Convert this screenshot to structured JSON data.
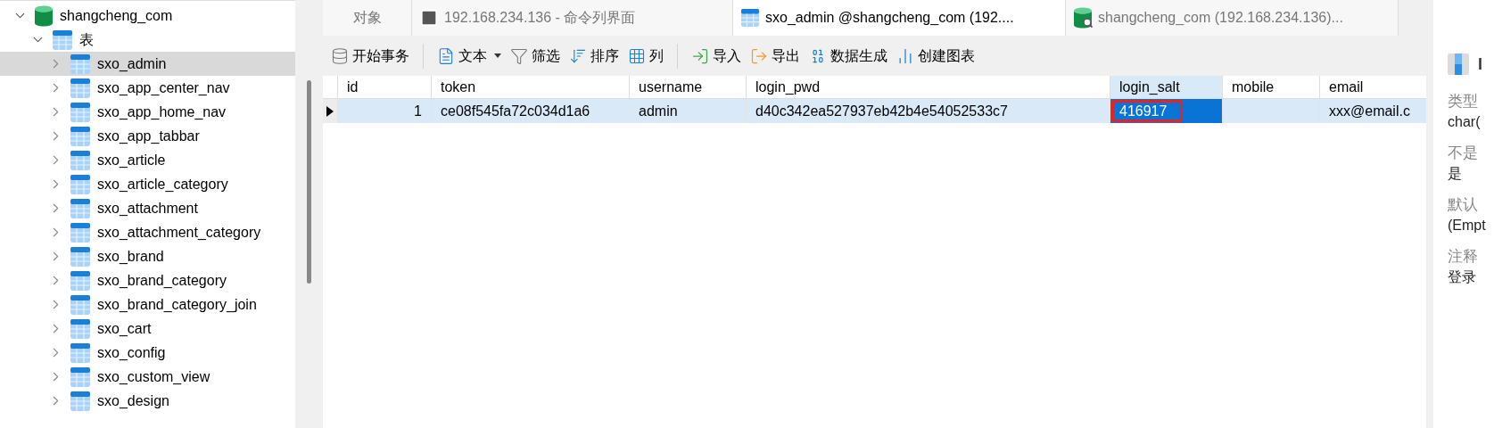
{
  "sidebar": {
    "tree": [
      {
        "label": "shangcheng_com",
        "kind": "database",
        "expanded": true,
        "selected": false,
        "children": [
          {
            "label": "表",
            "kind": "folder",
            "expanded": true,
            "selected": false,
            "children": [
              {
                "label": "sxo_admin",
                "kind": "table",
                "expanded": false,
                "selected": true
              },
              {
                "label": "sxo_app_center_nav",
                "kind": "table",
                "expanded": false,
                "selected": false
              },
              {
                "label": "sxo_app_home_nav",
                "kind": "table",
                "expanded": false,
                "selected": false
              },
              {
                "label": "sxo_app_tabbar",
                "kind": "table",
                "expanded": false,
                "selected": false
              },
              {
                "label": "sxo_article",
                "kind": "table",
                "expanded": false,
                "selected": false
              },
              {
                "label": "sxo_article_category",
                "kind": "table",
                "expanded": false,
                "selected": false
              },
              {
                "label": "sxo_attachment",
                "kind": "table",
                "expanded": false,
                "selected": false
              },
              {
                "label": "sxo_attachment_category",
                "kind": "table",
                "expanded": false,
                "selected": false
              },
              {
                "label": "sxo_brand",
                "kind": "table",
                "expanded": false,
                "selected": false
              },
              {
                "label": "sxo_brand_category",
                "kind": "table",
                "expanded": false,
                "selected": false
              },
              {
                "label": "sxo_brand_category_join",
                "kind": "table",
                "expanded": false,
                "selected": false
              },
              {
                "label": "sxo_cart",
                "kind": "table",
                "expanded": false,
                "selected": false
              },
              {
                "label": "sxo_config",
                "kind": "table",
                "expanded": false,
                "selected": false
              },
              {
                "label": "sxo_custom_view",
                "kind": "table",
                "expanded": false,
                "selected": false
              },
              {
                "label": "sxo_design",
                "kind": "table",
                "expanded": false,
                "selected": false
              }
            ]
          }
        ]
      }
    ]
  },
  "tabs": [
    {
      "label": "对象",
      "kind": "objects",
      "selected": false
    },
    {
      "label": "192.168.234.136 - 命令列界面",
      "kind": "console",
      "selected": false
    },
    {
      "label": "sxo_admin @shangcheng_com (192....",
      "kind": "table",
      "selected": true
    },
    {
      "label": "shangcheng_com (192.168.234.136)...",
      "kind": "database",
      "selected": false
    }
  ],
  "toolbar": [
    {
      "label": "开始事务",
      "kind": "transaction",
      "has_menu": false
    },
    {
      "label": "文本",
      "kind": "text",
      "has_menu": true
    },
    {
      "label": "筛选",
      "kind": "filter",
      "has_menu": false
    },
    {
      "label": "排序",
      "kind": "sort",
      "has_menu": false
    },
    {
      "label": "列",
      "kind": "columns",
      "has_menu": false
    },
    {
      "label": "导入",
      "kind": "import",
      "has_menu": false
    },
    {
      "label": "导出",
      "kind": "export",
      "has_menu": false
    },
    {
      "label": "数据生成",
      "kind": "generate",
      "has_menu": false
    },
    {
      "label": "创建图表",
      "kind": "chart",
      "has_menu": false
    }
  ],
  "grid": {
    "columns": [
      {
        "label": "id",
        "selected": false
      },
      {
        "label": "token",
        "selected": false
      },
      {
        "label": "username",
        "selected": false
      },
      {
        "label": "login_pwd",
        "selected": false
      },
      {
        "label": "login_salt",
        "selected": true
      },
      {
        "label": "mobile",
        "selected": false
      },
      {
        "label": "email",
        "selected": false
      }
    ],
    "rows": [
      {
        "current": true,
        "selected": true,
        "cells": [
          {
            "text": "1",
            "selected": false
          },
          {
            "text": "ce08f545fa72c034d1a6",
            "selected": false
          },
          {
            "text": "admin",
            "selected": false
          },
          {
            "text": "d40c342ea527937eb42b4e54052533c7",
            "selected": false
          },
          {
            "text": "416917",
            "selected": true,
            "highlighted": true
          },
          {
            "selected": false
          },
          {
            "text": "xxx@email.c",
            "selected": false
          }
        ]
      }
    ]
  },
  "details": {
    "title": "l",
    "fields": [
      {
        "label": "类型",
        "value": "char("
      },
      {
        "label": "不是",
        "value": "是"
      },
      {
        "label": "默认",
        "value": "(Empt"
      },
      {
        "label": "注释",
        "value": "登录"
      }
    ]
  }
}
